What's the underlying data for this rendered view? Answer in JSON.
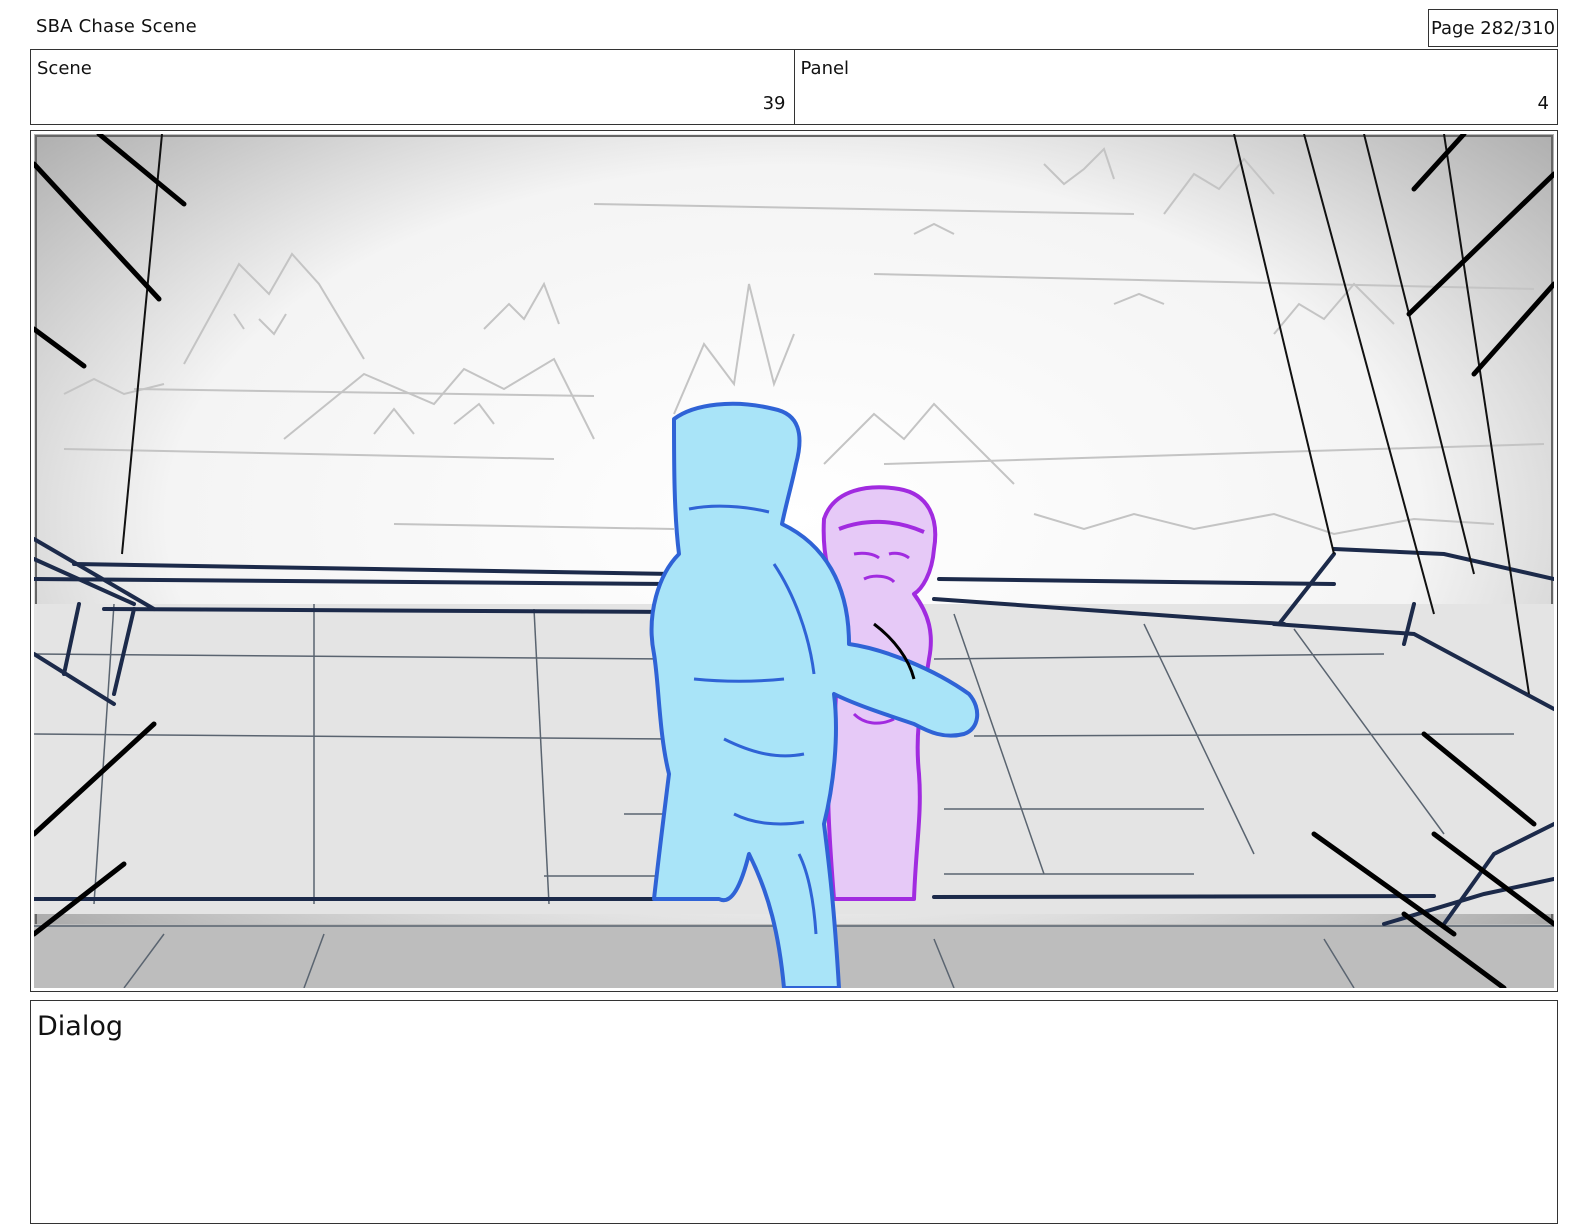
{
  "header": {
    "title": "SBA Chase Scene",
    "page": "Page 282/310"
  },
  "info": {
    "scene_label": "Scene",
    "scene_value": "39",
    "panel_label": "Panel",
    "panel_value": "4"
  },
  "dialog": {
    "label": "Dialog"
  },
  "colors": {
    "character_left": "#a9e4f8",
    "character_left_outline": "#2f63d6",
    "character_right": "#e6c9f7",
    "character_right_outline": "#a12be0",
    "railing": "#1c2a4a"
  }
}
